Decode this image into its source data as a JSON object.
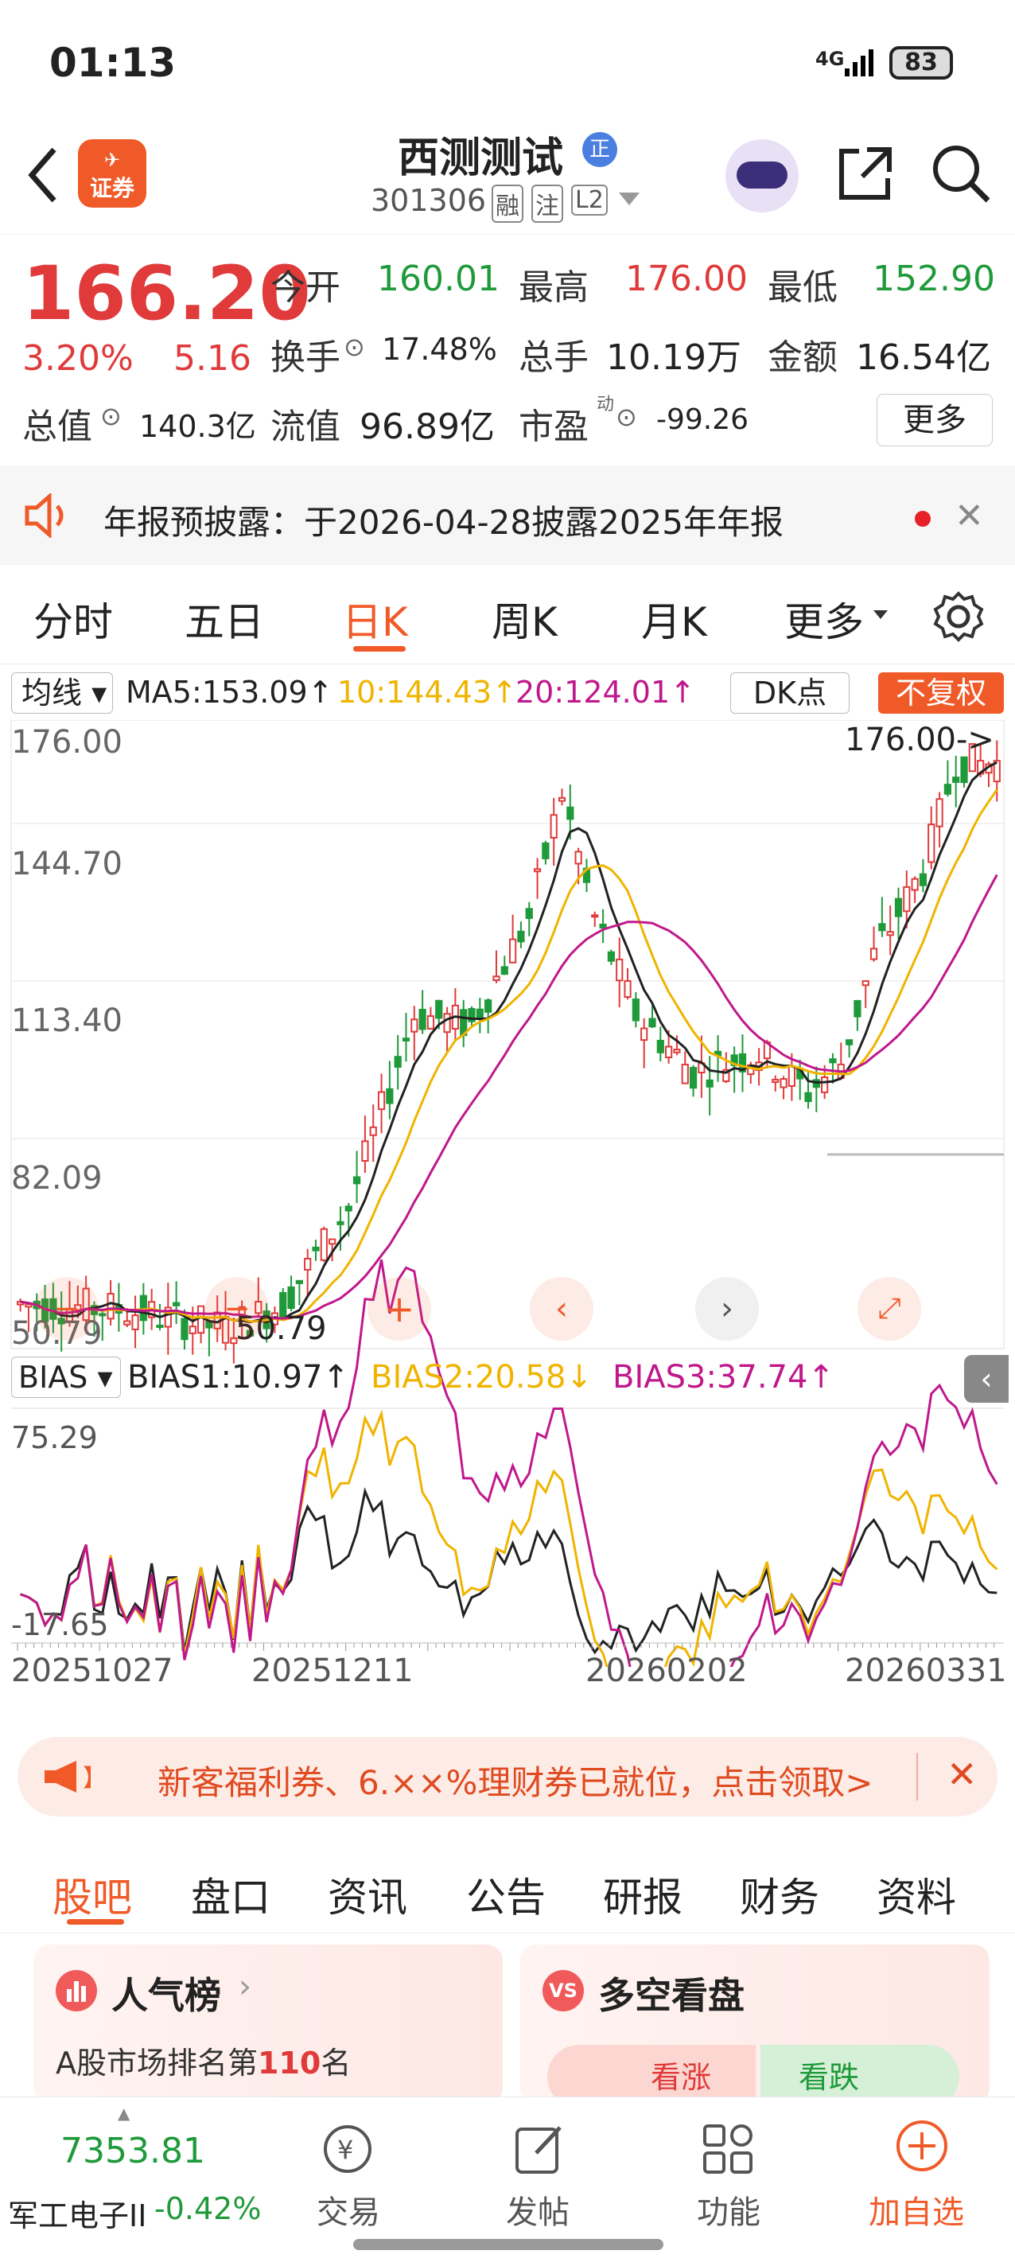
{
  "status": {
    "time": "01:13",
    "network": "4G",
    "battery": "83"
  },
  "nav": {
    "title": "西测测试",
    "title_badge": "正",
    "code": "301306",
    "tags": [
      "融",
      "注",
      "L2"
    ],
    "logo_text": "证券"
  },
  "quote": {
    "price": "166.20",
    "change_pct": "3.20%",
    "change": "5.16",
    "open_label": "今开",
    "open": "160.01",
    "high_label": "最高",
    "high": "176.00",
    "low_label": "最低",
    "low": "152.90",
    "turnover_label": "换手",
    "turnover": "17.48%",
    "volume_label": "总手",
    "volume": "10.19万",
    "amount_label": "金额",
    "amount": "16.54亿",
    "mcap_label": "总值",
    "mcap": "140.3亿",
    "float_label": "流值",
    "float": "96.89亿",
    "pe_label": "市盈",
    "pe_sup": "动",
    "pe": "-99.26",
    "more_label": "更多"
  },
  "notice": {
    "text": "年报预披露：于2026-04-28披露2025年年报"
  },
  "tabs": {
    "items": [
      "分时",
      "五日",
      "日K",
      "周K",
      "月K",
      "更多"
    ],
    "active": 2
  },
  "chart": {
    "ma_label": "均线",
    "ma5": "MA5:153.09↑",
    "ma10": "10:144.43↑",
    "ma20": "20:124.01↑",
    "dk_label": "DK点",
    "fq_label": "不复权",
    "y_ticks": [
      "176.00",
      "144.70",
      "113.40",
      "82.09",
      "50.79"
    ],
    "max_label": "176.00->",
    "min_label": "50.79",
    "bias_label": "BIAS",
    "bias1": "BIAS1:10.97↑",
    "bias2": "BIAS2:20.58↓",
    "bias3": "BIAS3:37.74↑",
    "bias_top": "75.29",
    "bias_bottom": "-17.65",
    "dates": [
      "20251027",
      "20251211",
      "20260202",
      "20260331"
    ],
    "colors": {
      "up": "#e03a3a",
      "down": "#1f9a3a",
      "ma5": "#222222",
      "ma10": "#f0b400",
      "ma20": "#c0188c"
    }
  },
  "chart_data": {
    "type": "candlestick",
    "ylim": [
      50.79,
      176.0
    ],
    "ma5_last": 153.09,
    "ma10_last": 144.43,
    "ma20_last": 124.01,
    "bias1": 10.97,
    "bias2": 20.58,
    "bias3": 37.74,
    "bias_ylim": [
      -17.65,
      75.29
    ],
    "dates": [
      "20251027",
      "20251211",
      "20260202",
      "20260331"
    ]
  },
  "promo": {
    "text": "新客福利券、6.××%理财券已就位，点击领取>"
  },
  "bottom_tabs": {
    "items": [
      "股吧",
      "盘口",
      "资讯",
      "公告",
      "研报",
      "财务",
      "资料"
    ],
    "active": 0
  },
  "cards": {
    "left_title": "人气榜",
    "left_sub_prefix": "A股市场排名第",
    "left_rank": "110",
    "left_sub_suffix": "名",
    "right_title": "多空看盘",
    "rise": "看涨",
    "fall": "看跌"
  },
  "footer": {
    "index_value": "7353.81",
    "index_name": "军工电子II",
    "index_change": "-0.42%",
    "trade": "交易",
    "post": "发帖",
    "func": "功能",
    "add": "加自选"
  }
}
